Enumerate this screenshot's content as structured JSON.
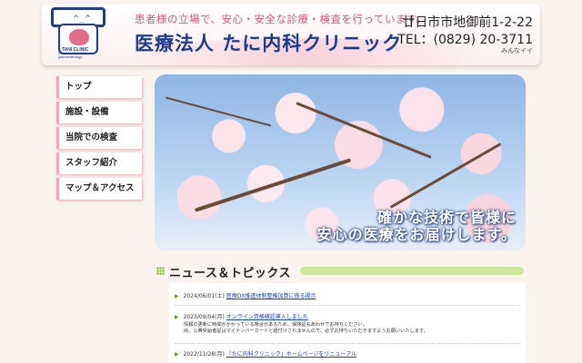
{
  "header": {
    "tagline": "患者様の立場で、安心・安全な診療・検査を行っています。",
    "clinic_name": "医療法人 たに内科クリニック",
    "address": "廿日市市地御前1-2-22",
    "tel": "TEL：(0829) 20-3711",
    "minna": "みんなイイ",
    "logo": {
      "face": "^_^",
      "name": "TANI CLINIC",
      "subtitle": "internal medicine & gastroenterology"
    }
  },
  "nav": {
    "items": [
      {
        "label": "トップ"
      },
      {
        "label": "施設・設備"
      },
      {
        "label": "当院での検査"
      },
      {
        "label": "スタッフ紹介"
      },
      {
        "label": "マップ＆アクセス"
      }
    ]
  },
  "hero": {
    "caption_line1": "確かな技術で皆様に",
    "caption_line2": "安心の医療をお届けします。"
  },
  "news": {
    "title": "ニュース＆トピックス",
    "items": [
      {
        "date": "2024/06/01(土)",
        "link": "医療DX推進体制整備加算に係る掲示",
        "body": ""
      },
      {
        "date": "2023/09/04(月)",
        "link": "オンライン資格確認導入しました",
        "body_line1": "情報の更新に時間がかかっている場合があるため、保険証もあわせてお持ちください。",
        "body_line2": "尚、公費受給者証はマイナンバーカードと紐付けされませんので、必ずお持ちいただきますようお願いいたします。"
      },
      {
        "date": "2022/11/28(月)",
        "link": "「たに内科クリニック」ホームページをリニューアル",
        "body": ""
      }
    ]
  },
  "colors": {
    "accent_pink": "#d9557a",
    "brand_navy": "#1f3a93",
    "news_green": "#8fc33f"
  }
}
